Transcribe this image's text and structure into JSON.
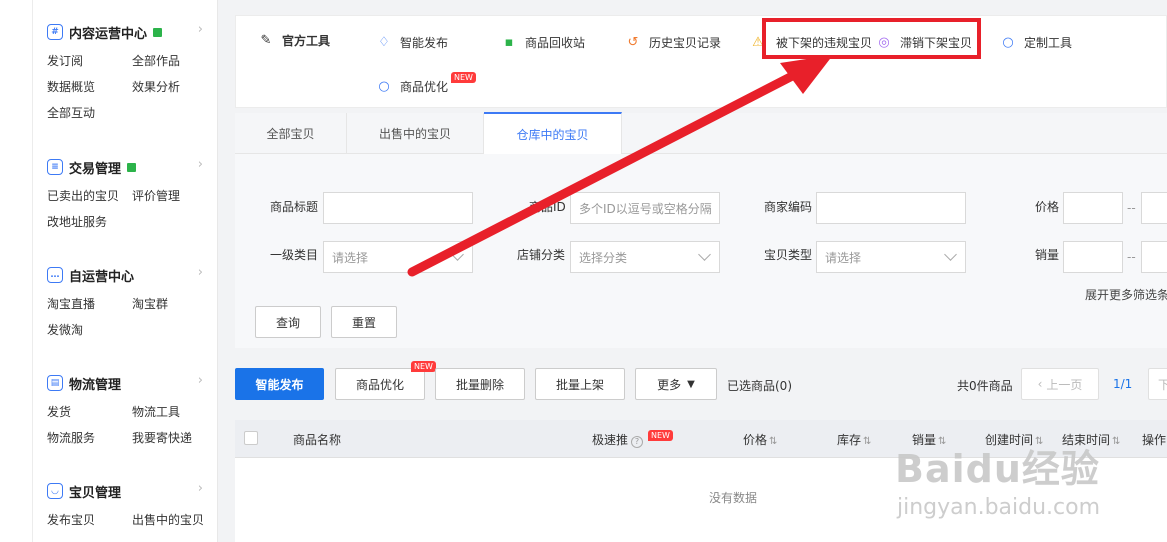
{
  "sidebar": {
    "content_ops": {
      "title": "内容运营中心",
      "items": [
        "发订阅",
        "全部作品",
        "数据概览",
        "效果分析",
        "全部互动"
      ]
    },
    "trade": {
      "title": "交易管理",
      "items": [
        "已卖出的宝贝",
        "评价管理",
        "改地址服务"
      ]
    },
    "self_ops": {
      "title": "自运营中心",
      "items": [
        "淘宝直播",
        "淘宝群",
        "发微淘"
      ]
    },
    "logistics": {
      "title": "物流管理",
      "items": [
        "发货",
        "物流工具",
        "物流服务",
        "我要寄快递"
      ]
    },
    "goods": {
      "title": "宝贝管理",
      "items": [
        "发布宝贝",
        "出售中的宝贝"
      ]
    },
    "chevron": "›"
  },
  "toolbar": {
    "official_tools": "官方工具",
    "smart_publish": "智能发布",
    "recycle_bin": "商品回收站",
    "history": "历史宝贝记录",
    "removed_violations": "被下架的违规宝贝",
    "slow_sales": "滞销下架宝贝",
    "custom_tools": "定制工具",
    "optimize": "商品优化",
    "new_badge": "NEW"
  },
  "tabs": [
    "全部宝贝",
    "出售中的宝贝",
    "仓库中的宝贝"
  ],
  "filters": {
    "title_label": "商品标题",
    "id_label": "商品ID",
    "id_placeholder": "多个ID以逗号或空格分隔",
    "merchant_code_label": "商家编码",
    "price_label": "价格",
    "category_label": "一级类目",
    "category_placeholder": "请选择",
    "shop_category_label": "店铺分类",
    "shop_category_placeholder": "选择分类",
    "type_label": "宝贝类型",
    "type_placeholder": "请选择",
    "sales_label": "销量",
    "range_sep": "--",
    "expand": "展开更多筛选条件",
    "query": "查询",
    "reset": "重置"
  },
  "actions": {
    "smart_publish": "智能发布",
    "optimize": "商品优化",
    "batch_delete": "批量删除",
    "batch_list": "批量上架",
    "more": "更多",
    "selected": "已选商品(0)",
    "total": "共0件商品",
    "prev": "上一页",
    "page": "1/1",
    "next": "下"
  },
  "table": {
    "name": "商品名称",
    "boost": "极速推",
    "price": "价格",
    "stock": "库存",
    "sales": "销量",
    "created": "创建时间",
    "end": "结束时间",
    "ops": "操作",
    "empty": "没有数据"
  },
  "watermark": {
    "brand": "Baidu经验",
    "url": "jingyan.baidu.com"
  },
  "colors": {
    "accent": "#1a73e8",
    "highlight": "#e8202a",
    "new": "#ff3b3b"
  }
}
